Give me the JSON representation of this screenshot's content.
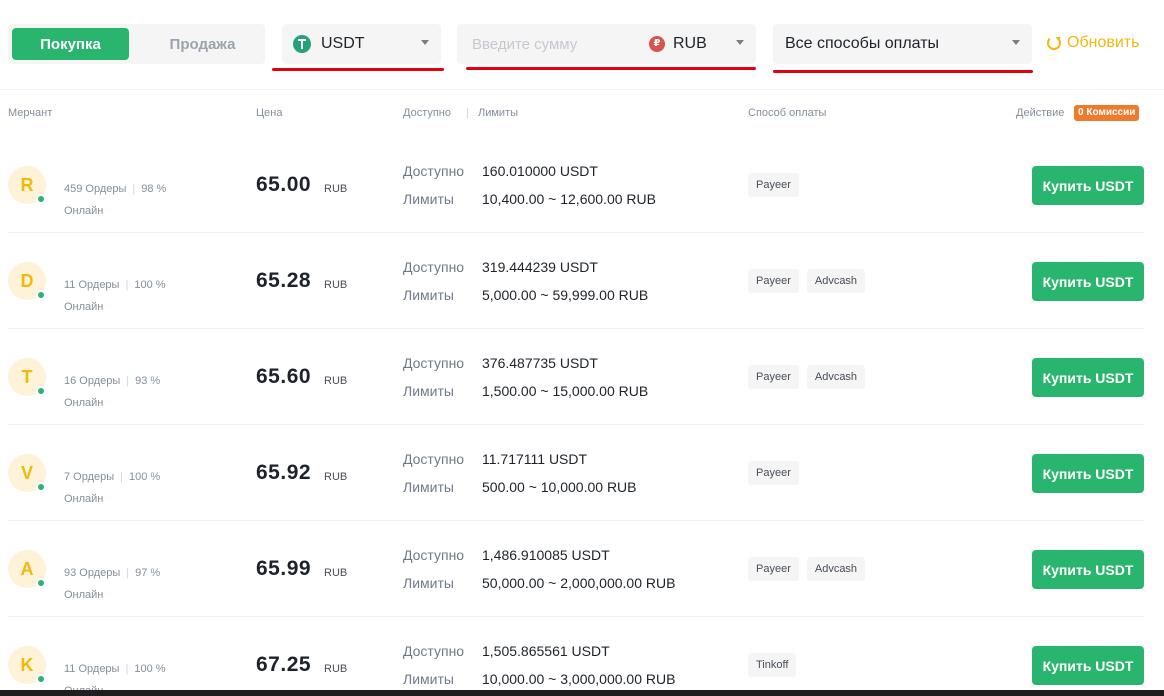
{
  "tabs": {
    "buy": "Покупка",
    "sell": "Продажа"
  },
  "filters": {
    "coin": {
      "value": "USDT",
      "icon": "tether-icon",
      "color": "#26a17b"
    },
    "amount": {
      "placeholder": "Введите сумму",
      "currency": "RUB",
      "currency_symbol": "₽",
      "icon": "ruble-icon"
    },
    "payment": {
      "value": "Все способы оплаты"
    },
    "refresh": "Обновить"
  },
  "table_header": {
    "merchant": "Мерчант",
    "price": "Цена",
    "available": "Доступно",
    "separator": "|",
    "limits": "Лимиты",
    "payment": "Способ оплаты",
    "action": "Действие",
    "commission_badge": "0 Комиссии"
  },
  "colors": {
    "accent_green": "#2ab56f",
    "accent_yellow": "#f0b90b",
    "highlight_red": "#e3000f",
    "commission_orange": "#f07a2c"
  },
  "rows": [
    {
      "initial": "R",
      "orders": "459 Ордеры",
      "completion": "98 %",
      "status": "Онлайн",
      "price": "65.00",
      "currency": "RUB",
      "available_label": "Доступно",
      "available": "160.010000 USDT",
      "limits_label": "Лимиты",
      "limits": "10,400.00 ~ 12,600.00 RUB",
      "payments": [
        "Payeer"
      ],
      "button": "Купить USDT"
    },
    {
      "initial": "D",
      "orders": "11 Ордеры",
      "completion": "100 %",
      "status": "Онлайн",
      "price": "65.28",
      "currency": "RUB",
      "available_label": "Доступно",
      "available": "319.444239 USDT",
      "limits_label": "Лимиты",
      "limits": "5,000.00 ~ 59,999.00 RUB",
      "payments": [
        "Payeer",
        "Advcash"
      ],
      "button": "Купить USDT"
    },
    {
      "initial": "T",
      "orders": "16 Ордеры",
      "completion": "93 %",
      "status": "Онлайн",
      "price": "65.60",
      "currency": "RUB",
      "available_label": "Доступно",
      "available": "376.487735 USDT",
      "limits_label": "Лимиты",
      "limits": "1,500.00 ~ 15,000.00 RUB",
      "payments": [
        "Payeer",
        "Advcash"
      ],
      "button": "Купить USDT"
    },
    {
      "initial": "V",
      "orders": "7 Ордеры",
      "completion": "100 %",
      "status": "Онлайн",
      "price": "65.92",
      "currency": "RUB",
      "available_label": "Доступно",
      "available": "11.717111 USDT",
      "limits_label": "Лимиты",
      "limits": "500.00 ~ 10,000.00 RUB",
      "payments": [
        "Payeer"
      ],
      "button": "Купить USDT"
    },
    {
      "initial": "A",
      "orders": "93 Ордеры",
      "completion": "97 %",
      "status": "Онлайн",
      "price": "65.99",
      "currency": "RUB",
      "available_label": "Доступно",
      "available": "1,486.910085 USDT",
      "limits_label": "Лимиты",
      "limits": "50,000.00 ~ 2,000,000.00 RUB",
      "payments": [
        "Payeer",
        "Advcash"
      ],
      "button": "Купить USDT"
    },
    {
      "initial": "K",
      "orders": "11 Ордеры",
      "completion": "100 %",
      "status": "Онлайн",
      "price": "67.25",
      "currency": "RUB",
      "available_label": "Доступно",
      "available": "1,505.865561 USDT",
      "limits_label": "Лимиты",
      "limits": "10,000.00 ~ 3,000,000.00 RUB",
      "payments": [
        "Tinkoff"
      ],
      "button": "Купить USDT"
    }
  ]
}
